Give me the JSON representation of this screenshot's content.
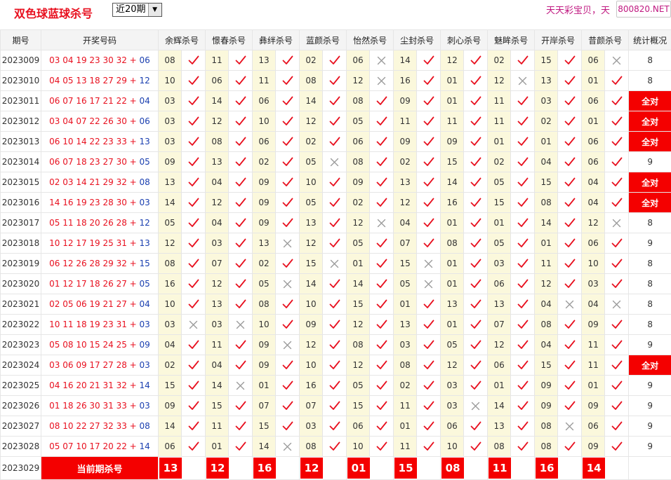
{
  "header": {
    "title": "双色球蓝球杀号",
    "period_select": "近20期",
    "promo_text": "天天彩宝贝，天",
    "badge": "800820.NET"
  },
  "columns": [
    "期号",
    "开奖号码",
    "余辉杀号",
    "憬春杀号",
    "彝绊杀号",
    "蓝颜杀号",
    "怡然杀号",
    "尘封杀号",
    "刺心杀号",
    "魅眸杀号",
    "开岸杀号",
    "昔颜杀号",
    "统计概况"
  ],
  "rows": [
    {
      "issue": "2023009",
      "red": "03 04 19 23 30 32",
      "blue": "06",
      "kills": [
        [
          "08",
          1
        ],
        [
          "11",
          1
        ],
        [
          "13",
          1
        ],
        [
          "02",
          1
        ],
        [
          "06",
          0
        ],
        [
          "14",
          1
        ],
        [
          "12",
          1
        ],
        [
          "02",
          1
        ],
        [
          "15",
          1
        ],
        [
          "06",
          0
        ]
      ],
      "stat": "8"
    },
    {
      "issue": "2023010",
      "red": "04 05 13 18 27 29",
      "blue": "12",
      "kills": [
        [
          "10",
          1
        ],
        [
          "06",
          1
        ],
        [
          "11",
          1
        ],
        [
          "08",
          1
        ],
        [
          "12",
          0
        ],
        [
          "16",
          1
        ],
        [
          "01",
          1
        ],
        [
          "12",
          0
        ],
        [
          "13",
          1
        ],
        [
          "01",
          1
        ]
      ],
      "stat": "8"
    },
    {
      "issue": "2023011",
      "red": "06 07 16 17 21 22",
      "blue": "04",
      "kills": [
        [
          "03",
          1
        ],
        [
          "14",
          1
        ],
        [
          "06",
          1
        ],
        [
          "14",
          1
        ],
        [
          "08",
          1
        ],
        [
          "09",
          1
        ],
        [
          "01",
          1
        ],
        [
          "11",
          1
        ],
        [
          "03",
          1
        ],
        [
          "06",
          1
        ]
      ],
      "stat": "全对"
    },
    {
      "issue": "2023012",
      "red": "03 04 07 22 26 30",
      "blue": "06",
      "kills": [
        [
          "03",
          1
        ],
        [
          "12",
          1
        ],
        [
          "10",
          1
        ],
        [
          "12",
          1
        ],
        [
          "05",
          1
        ],
        [
          "11",
          1
        ],
        [
          "11",
          1
        ],
        [
          "11",
          1
        ],
        [
          "02",
          1
        ],
        [
          "01",
          1
        ]
      ],
      "stat": "全对"
    },
    {
      "issue": "2023013",
      "red": "06 10 14 22 23 33",
      "blue": "13",
      "kills": [
        [
          "03",
          1
        ],
        [
          "08",
          1
        ],
        [
          "06",
          1
        ],
        [
          "02",
          1
        ],
        [
          "06",
          1
        ],
        [
          "09",
          1
        ],
        [
          "09",
          1
        ],
        [
          "01",
          1
        ],
        [
          "01",
          1
        ],
        [
          "06",
          1
        ]
      ],
      "stat": "全对"
    },
    {
      "issue": "2023014",
      "red": "06 07 18 23 27 30",
      "blue": "05",
      "kills": [
        [
          "09",
          1
        ],
        [
          "13",
          1
        ],
        [
          "02",
          1
        ],
        [
          "05",
          0
        ],
        [
          "08",
          1
        ],
        [
          "02",
          1
        ],
        [
          "15",
          1
        ],
        [
          "02",
          1
        ],
        [
          "04",
          1
        ],
        [
          "06",
          1
        ]
      ],
      "stat": "9"
    },
    {
      "issue": "2023015",
      "red": "02 03 14 21 29 32",
      "blue": "08",
      "kills": [
        [
          "13",
          1
        ],
        [
          "04",
          1
        ],
        [
          "09",
          1
        ],
        [
          "10",
          1
        ],
        [
          "09",
          1
        ],
        [
          "13",
          1
        ],
        [
          "14",
          1
        ],
        [
          "05",
          1
        ],
        [
          "15",
          1
        ],
        [
          "04",
          1
        ]
      ],
      "stat": "全对"
    },
    {
      "issue": "2023016",
      "red": "14 16 19 23 28 30",
      "blue": "03",
      "kills": [
        [
          "14",
          1
        ],
        [
          "12",
          1
        ],
        [
          "09",
          1
        ],
        [
          "05",
          1
        ],
        [
          "02",
          1
        ],
        [
          "12",
          1
        ],
        [
          "16",
          1
        ],
        [
          "15",
          1
        ],
        [
          "08",
          1
        ],
        [
          "04",
          1
        ]
      ],
      "stat": "全对"
    },
    {
      "issue": "2023017",
      "red": "05 11 18 20 26 28",
      "blue": "12",
      "kills": [
        [
          "05",
          1
        ],
        [
          "04",
          1
        ],
        [
          "09",
          1
        ],
        [
          "13",
          1
        ],
        [
          "12",
          0
        ],
        [
          "04",
          1
        ],
        [
          "01",
          1
        ],
        [
          "01",
          1
        ],
        [
          "14",
          1
        ],
        [
          "12",
          0
        ]
      ],
      "stat": "8"
    },
    {
      "issue": "2023018",
      "red": "10 12 17 19 25 31",
      "blue": "13",
      "kills": [
        [
          "12",
          1
        ],
        [
          "03",
          1
        ],
        [
          "13",
          0
        ],
        [
          "12",
          1
        ],
        [
          "05",
          1
        ],
        [
          "07",
          1
        ],
        [
          "08",
          1
        ],
        [
          "05",
          1
        ],
        [
          "01",
          1
        ],
        [
          "06",
          1
        ]
      ],
      "stat": "9"
    },
    {
      "issue": "2023019",
      "red": "06 12 26 28 29 32",
      "blue": "15",
      "kills": [
        [
          "08",
          1
        ],
        [
          "07",
          1
        ],
        [
          "02",
          1
        ],
        [
          "15",
          0
        ],
        [
          "01",
          1
        ],
        [
          "15",
          0
        ],
        [
          "01",
          1
        ],
        [
          "03",
          1
        ],
        [
          "11",
          1
        ],
        [
          "10",
          1
        ]
      ],
      "stat": "8"
    },
    {
      "issue": "2023020",
      "red": "01 12 17 18 26 27",
      "blue": "05",
      "kills": [
        [
          "16",
          1
        ],
        [
          "12",
          1
        ],
        [
          "05",
          0
        ],
        [
          "14",
          1
        ],
        [
          "14",
          1
        ],
        [
          "05",
          0
        ],
        [
          "01",
          1
        ],
        [
          "06",
          1
        ],
        [
          "12",
          1
        ],
        [
          "03",
          1
        ]
      ],
      "stat": "8"
    },
    {
      "issue": "2023021",
      "red": "02 05 06 19 21 27",
      "blue": "04",
      "kills": [
        [
          "10",
          1
        ],
        [
          "13",
          1
        ],
        [
          "08",
          1
        ],
        [
          "10",
          1
        ],
        [
          "15",
          1
        ],
        [
          "01",
          1
        ],
        [
          "13",
          1
        ],
        [
          "13",
          1
        ],
        [
          "04",
          0
        ],
        [
          "04",
          0
        ]
      ],
      "stat": "8"
    },
    {
      "issue": "2023022",
      "red": "10 11 18 19 23 31",
      "blue": "03",
      "kills": [
        [
          "03",
          0
        ],
        [
          "03",
          0
        ],
        [
          "10",
          1
        ],
        [
          "09",
          1
        ],
        [
          "12",
          1
        ],
        [
          "13",
          1
        ],
        [
          "01",
          1
        ],
        [
          "07",
          1
        ],
        [
          "08",
          1
        ],
        [
          "09",
          1
        ]
      ],
      "stat": "8"
    },
    {
      "issue": "2023023",
      "red": "05 08 10 15 24 25",
      "blue": "09",
      "kills": [
        [
          "04",
          1
        ],
        [
          "11",
          1
        ],
        [
          "09",
          0
        ],
        [
          "12",
          1
        ],
        [
          "08",
          1
        ],
        [
          "03",
          1
        ],
        [
          "05",
          1
        ],
        [
          "12",
          1
        ],
        [
          "04",
          1
        ],
        [
          "11",
          1
        ]
      ],
      "stat": "9"
    },
    {
      "issue": "2023024",
      "red": "03 06 09 17 27 28",
      "blue": "03",
      "kills": [
        [
          "02",
          1
        ],
        [
          "04",
          1
        ],
        [
          "09",
          1
        ],
        [
          "10",
          1
        ],
        [
          "12",
          1
        ],
        [
          "08",
          1
        ],
        [
          "12",
          1
        ],
        [
          "06",
          1
        ],
        [
          "15",
          1
        ],
        [
          "11",
          1
        ]
      ],
      "stat": "全对"
    },
    {
      "issue": "2023025",
      "red": "04 16 20 21 31 32",
      "blue": "14",
      "kills": [
        [
          "15",
          1
        ],
        [
          "14",
          0
        ],
        [
          "01",
          1
        ],
        [
          "16",
          1
        ],
        [
          "05",
          1
        ],
        [
          "02",
          1
        ],
        [
          "03",
          1
        ],
        [
          "01",
          1
        ],
        [
          "09",
          1
        ],
        [
          "01",
          1
        ]
      ],
      "stat": "9"
    },
    {
      "issue": "2023026",
      "red": "01 18 26 30 31 33",
      "blue": "03",
      "kills": [
        [
          "09",
          1
        ],
        [
          "15",
          1
        ],
        [
          "07",
          1
        ],
        [
          "07",
          1
        ],
        [
          "15",
          1
        ],
        [
          "11",
          1
        ],
        [
          "03",
          0
        ],
        [
          "14",
          1
        ],
        [
          "09",
          1
        ],
        [
          "09",
          1
        ]
      ],
      "stat": "9"
    },
    {
      "issue": "2023027",
      "red": "08 10 22 27 32 33",
      "blue": "08",
      "kills": [
        [
          "14",
          1
        ],
        [
          "11",
          1
        ],
        [
          "15",
          1
        ],
        [
          "03",
          1
        ],
        [
          "06",
          1
        ],
        [
          "01",
          1
        ],
        [
          "06",
          1
        ],
        [
          "13",
          1
        ],
        [
          "08",
          0
        ],
        [
          "06",
          1
        ]
      ],
      "stat": "9"
    },
    {
      "issue": "2023028",
      "red": "05 07 10 17 20 22",
      "blue": "14",
      "kills": [
        [
          "06",
          1
        ],
        [
          "01",
          1
        ],
        [
          "14",
          0
        ],
        [
          "08",
          1
        ],
        [
          "10",
          1
        ],
        [
          "11",
          1
        ],
        [
          "10",
          1
        ],
        [
          "08",
          1
        ],
        [
          "08",
          1
        ],
        [
          "09",
          1
        ]
      ],
      "stat": "9"
    }
  ],
  "current": {
    "issue": "2023029",
    "label": "当前期杀号",
    "nums": [
      "13",
      "12",
      "16",
      "12",
      "01",
      "15",
      "08",
      "11",
      "16",
      "14"
    ]
  },
  "colors": {
    "accent": "#f40000",
    "red_text": "#e8101f",
    "blue_text": "#1a3fb0",
    "kill_bg": "#fbf8dc",
    "cross": "#999999"
  }
}
